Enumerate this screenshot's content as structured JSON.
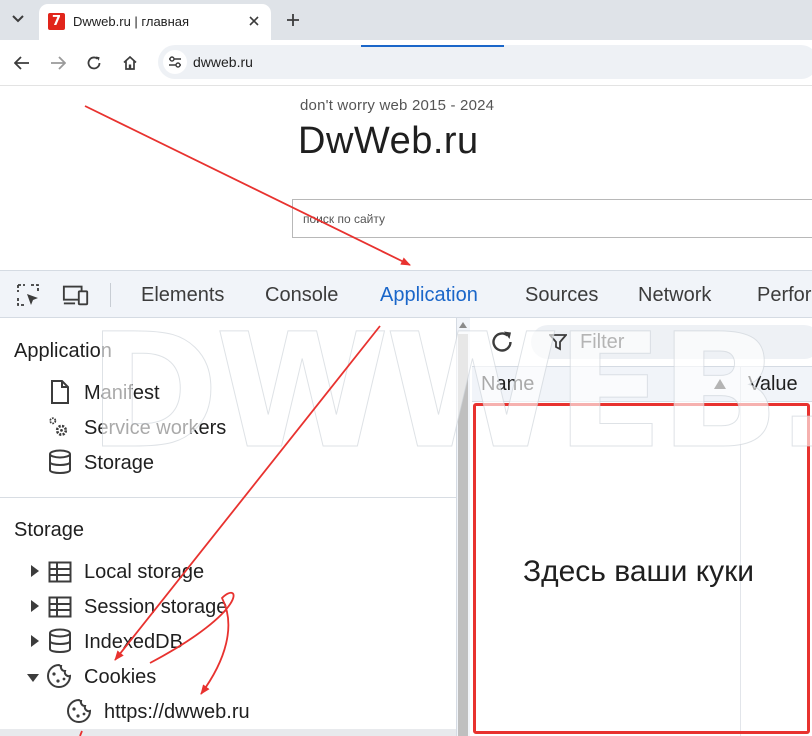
{
  "browser": {
    "tab_title": "Dwweb.ru | главная",
    "favicon_text": "7",
    "url": "dwweb.ru"
  },
  "page": {
    "tagline": "don't worry web 2015 - 2024",
    "title": "DwWeb.ru",
    "search_placeholder": "поиск по сайту"
  },
  "devtools": {
    "tabs": [
      "Elements",
      "Console",
      "Application",
      "Sources",
      "Network",
      "Perfor"
    ],
    "active_tab": "Application",
    "sidebar": {
      "application_header": "Application",
      "application_items": [
        "Manifest",
        "Service workers",
        "Storage"
      ],
      "storage_header": "Storage",
      "storage_items": [
        "Local storage",
        "Session storage",
        "IndexedDB",
        "Cookies"
      ],
      "cookie_origin": "https://dwweb.ru"
    },
    "filter_placeholder": "Filter",
    "columns": [
      "Name",
      "Value"
    ]
  },
  "annotation": {
    "note": "Здесь ваши куки",
    "color": "#e8322f"
  },
  "watermark": "DWWEB.RU"
}
